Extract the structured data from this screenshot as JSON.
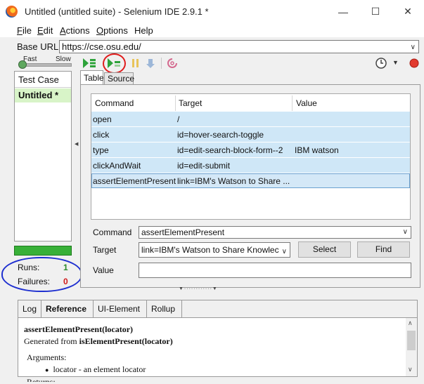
{
  "window": {
    "title": "Untitled (untitled suite) - Selenium IDE 2.9.1 *",
    "minimize": "—",
    "maximize": "☐",
    "close": "✕"
  },
  "menu": [
    {
      "label": "File",
      "u": "F",
      "rest": "ile"
    },
    {
      "label": "Edit",
      "u": "E",
      "rest": "dit"
    },
    {
      "label": "Actions",
      "u": "A",
      "rest": "ctions"
    },
    {
      "label": "Options",
      "u": "O",
      "rest": "ptions"
    },
    {
      "label": "Help",
      "u": "",
      "rest": "Help"
    }
  ],
  "base_url": {
    "label": "Base URL",
    "value": "https://cse.osu.edu/"
  },
  "speed": {
    "fast": "Fast",
    "slow": "Slow",
    "level": 0
  },
  "toolbar": {
    "icons": [
      "play-suite-icon",
      "play-test-icon",
      "pause-icon",
      "step-icon",
      "rollup-icon",
      "schedule-icon",
      "record-icon"
    ]
  },
  "test_case_panel": {
    "header": "Test Case",
    "items": [
      "Untitled *"
    ]
  },
  "status": {
    "runs_label": "Runs:",
    "runs": "1",
    "failures_label": "Failures:",
    "failures": "0",
    "progress": 1.0
  },
  "editor_tabs": [
    "Table",
    "Source"
  ],
  "grid": {
    "headers": [
      "Command",
      "Target",
      "Value"
    ],
    "rows": [
      {
        "command": "open",
        "target": "/",
        "value": ""
      },
      {
        "command": "click",
        "target": "id=hover-search-toggle",
        "value": ""
      },
      {
        "command": "type",
        "target": "id=edit-search-block-form--2",
        "value": "IBM watson"
      },
      {
        "command": "clickAndWait",
        "target": "id=edit-submit",
        "value": ""
      },
      {
        "command": "assertElementPresent",
        "target": "link=IBM's Watson to Share ...",
        "value": ""
      }
    ]
  },
  "fields": {
    "command_label": "Command",
    "command_value": "assertElementPresent",
    "target_label": "Target",
    "target_value": "link=IBM's Watson to Share Knowlec",
    "value_label": "Value",
    "value_value": "",
    "select_button": "Select",
    "find_button": "Find"
  },
  "bottom_tabs": [
    "Log",
    "Reference",
    "UI-Element",
    "Rollup"
  ],
  "reference": {
    "signature": "assertElementPresent(locator)",
    "generated_prefix": "Generated from ",
    "generated_from": "isElementPresent(locator)",
    "arguments_label": "Arguments:",
    "argument": "locator - an element locator",
    "returns_label": "Returns:"
  }
}
